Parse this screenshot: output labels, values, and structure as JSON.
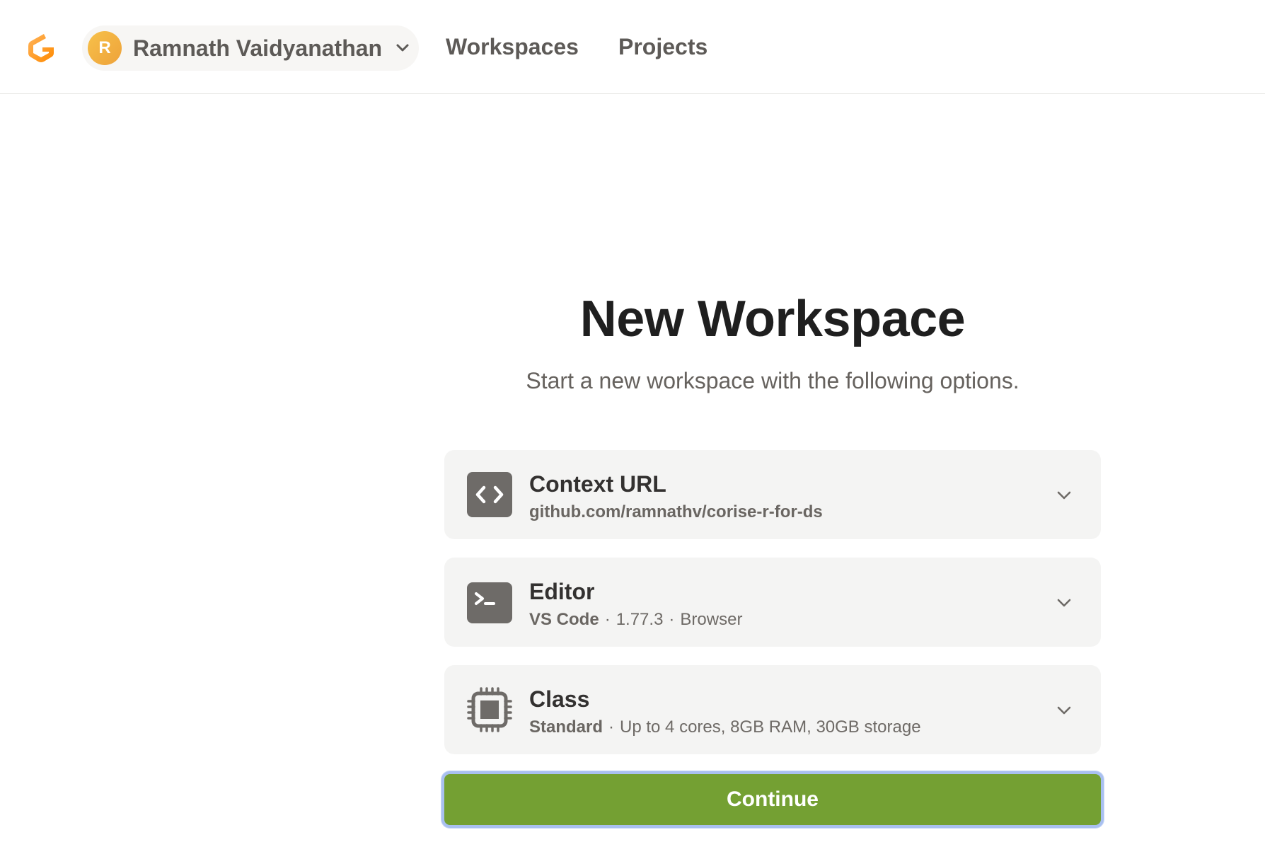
{
  "header": {
    "logo_icon": "gitpod-logo-icon",
    "account": {
      "avatar_initial": "R",
      "name": "Ramnath Vaidyanathan",
      "dropdown_icon": "chevron-down-icon"
    },
    "nav": [
      {
        "label": "Workspaces"
      },
      {
        "label": "Projects"
      }
    ]
  },
  "main": {
    "title": "New Workspace",
    "subtitle": "Start a new workspace with the following options.",
    "options": [
      {
        "icon": "code-brackets-icon",
        "title": "Context URL",
        "value": "github.com/ramnathv/corise-r-for-ds"
      },
      {
        "icon": "terminal-icon",
        "title": "Editor",
        "value_name": "VS Code",
        "separator": "·",
        "version": "1.77.3",
        "mode": "Browser"
      },
      {
        "icon": "cpu-chip-icon",
        "title": "Class",
        "value_name": "Standard",
        "separator": "·",
        "details": "Up to 4 cores, 8GB RAM, 30GB storage"
      }
    ],
    "continue_label": "Continue"
  },
  "colors": {
    "brand_orange": "#f59e3a",
    "continue_green": "#74a033",
    "focus_ring": "#a9c0f0",
    "card_bg": "#f4f4f3"
  }
}
